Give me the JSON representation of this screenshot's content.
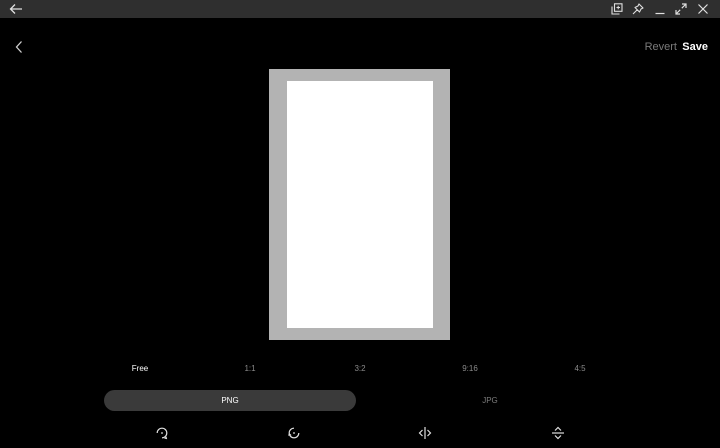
{
  "header": {
    "revert_label": "Revert",
    "save_label": "Save"
  },
  "ratios": [
    "Free",
    "1:1",
    "3:2",
    "9:16",
    "4:5"
  ],
  "selected_ratio": "Free",
  "formats": [
    "PNG",
    "JPG"
  ],
  "selected_format": "PNG",
  "icons": {
    "titlebar_back": "back-arrow-icon",
    "titlebar_buttons": [
      "snap-layout-icon",
      "pin-icon",
      "minimize-icon",
      "maximize-icon",
      "close-icon"
    ],
    "app_back": "chevron-left-icon",
    "tools": [
      "rotate-right-icon",
      "rotate-left-icon",
      "flip-horizontal-icon",
      "flip-vertical-icon"
    ]
  },
  "colors": {
    "background": "#000000",
    "titlebar": "#2f2f2f",
    "frame": "#b3b3b3",
    "image": "#ffffff",
    "toggle_active": "#3a3a3a",
    "muted_text": "#7a7a7a"
  }
}
